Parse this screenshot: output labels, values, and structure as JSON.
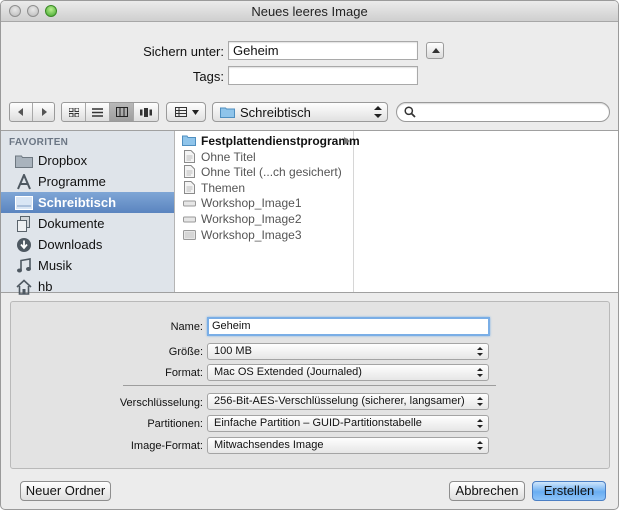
{
  "window": {
    "title": "Neues leeres Image"
  },
  "save_form": {
    "save_as_label": "Sichern unter:",
    "save_as_value": "Geheim",
    "tags_label": "Tags:",
    "tags_value": ""
  },
  "toolbar": {
    "location": "Schreibtisch"
  },
  "sidebar": {
    "heading": "FAVORITEN",
    "items": [
      {
        "label": "Dropbox",
        "icon": "folder-icon"
      },
      {
        "label": "Programme",
        "icon": "applications-icon"
      },
      {
        "label": "Schreibtisch",
        "icon": "desktop-icon",
        "selected": true
      },
      {
        "label": "Dokumente",
        "icon": "documents-icon"
      },
      {
        "label": "Downloads",
        "icon": "downloads-icon"
      },
      {
        "label": "Musik",
        "icon": "music-icon"
      },
      {
        "label": "hb",
        "icon": "home-icon"
      }
    ]
  },
  "files": [
    {
      "name": "Festplattendienstprogramm",
      "icon": "folder-icon",
      "enabled": true
    },
    {
      "name": "Ohne Titel",
      "icon": "document-icon",
      "enabled": false
    },
    {
      "name": "Ohne Titel (...ch gesichert)",
      "icon": "document-icon",
      "enabled": false
    },
    {
      "name": "Themen",
      "icon": "document-icon",
      "enabled": false
    },
    {
      "name": "Workshop_Image1",
      "icon": "disk-image-icon",
      "enabled": false
    },
    {
      "name": "Workshop_Image2",
      "icon": "disk-image-icon",
      "enabled": false
    },
    {
      "name": "Workshop_Image3",
      "icon": "disk-image-icon",
      "enabled": false
    }
  ],
  "options": {
    "name_label": "Name:",
    "name_value": "Geheim",
    "size_label": "Größe:",
    "size_value": "100 MB",
    "format_label": "Format:",
    "format_value": "Mac OS Extended (Journaled)",
    "encryption_label": "Verschlüsselung:",
    "encryption_value": "256-Bit-AES-Verschlüsselung (sicherer, langsamer)",
    "partitions_label": "Partitionen:",
    "partitions_value": "Einfache Partition – GUID-Partitionstabelle",
    "image_format_label": "Image-Format:",
    "image_format_value": "Mitwachsendes Image"
  },
  "buttons": {
    "new_folder": "Neuer Ordner",
    "cancel": "Abbrechen",
    "create": "Erstellen"
  }
}
